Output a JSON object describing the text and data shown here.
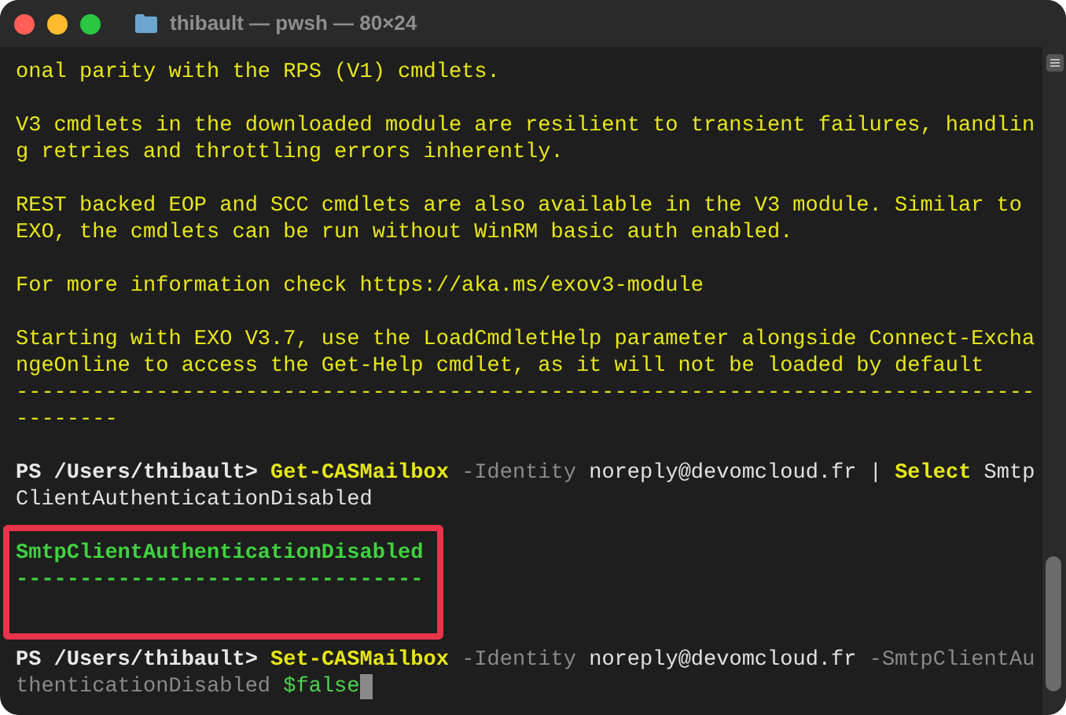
{
  "window": {
    "title": "thibault — pwsh — 80×24"
  },
  "terminal": {
    "lines": [
      {
        "kind": "text",
        "segments": [
          {
            "kind": "output",
            "text": "onal parity with the RPS (V1) cmdlets."
          }
        ]
      },
      {
        "kind": "blank"
      },
      {
        "kind": "text",
        "segments": [
          {
            "kind": "output",
            "text": "V3 cmdlets in the downloaded module are resilient to transient failures, handlin"
          }
        ]
      },
      {
        "kind": "text",
        "segments": [
          {
            "kind": "output",
            "text": "g retries and throttling errors inherently."
          }
        ]
      },
      {
        "kind": "blank"
      },
      {
        "kind": "text",
        "segments": [
          {
            "kind": "output",
            "text": "REST backed EOP and SCC cmdlets are also available in the V3 module. Similar to"
          }
        ]
      },
      {
        "kind": "text",
        "segments": [
          {
            "kind": "output",
            "text": "EXO, the cmdlets can be run without WinRM basic auth enabled."
          }
        ]
      },
      {
        "kind": "blank"
      },
      {
        "kind": "text",
        "segments": [
          {
            "kind": "output",
            "text": "For more information check https://aka.ms/exov3-module"
          }
        ]
      },
      {
        "kind": "blank"
      },
      {
        "kind": "text",
        "segments": [
          {
            "kind": "output",
            "text": "Starting with EXO V3.7, use the LoadCmdletHelp parameter alongside Connect-Excha"
          }
        ]
      },
      {
        "kind": "text",
        "segments": [
          {
            "kind": "output",
            "text": "ngeOnline to access the Get-Help cmdlet, as it will not be loaded by default"
          }
        ]
      },
      {
        "kind": "text",
        "segments": [
          {
            "kind": "output",
            "text": "--------------------------------------------------------------------------------"
          }
        ]
      },
      {
        "kind": "text",
        "segments": [
          {
            "kind": "output",
            "text": "--------"
          }
        ]
      },
      {
        "kind": "blank"
      },
      {
        "kind": "text",
        "segments": [
          {
            "kind": "prompt",
            "text": "PS /Users/thibault>"
          },
          {
            "kind": "command",
            "text": "Get-CASMailbox"
          },
          {
            "kind": "parameter",
            "text": "-Identity"
          },
          {
            "kind": "argument",
            "text": "noreply@devomcloud.fr"
          },
          {
            "kind": "argument",
            "text": "|"
          },
          {
            "kind": "command",
            "text": "Select"
          },
          {
            "kind": "argument",
            "text": "Smtp"
          }
        ]
      },
      {
        "kind": "text",
        "segments": [
          {
            "kind": "argument",
            "text": "ClientAuthenticationDisabled"
          }
        ]
      },
      {
        "kind": "blank"
      },
      {
        "kind": "box",
        "lines": [
          {
            "kind": "text",
            "segments": [
              {
                "kind": "result",
                "text": "SmtpClientAuthenticationDisabled"
              }
            ]
          },
          {
            "kind": "text",
            "segments": [
              {
                "kind": "result",
                "text": "--------------------------------"
              }
            ]
          },
          {
            "kind": "blank"
          }
        ]
      },
      {
        "kind": "blank"
      },
      {
        "kind": "text",
        "segments": [
          {
            "kind": "prompt",
            "text": "PS /Users/thibault>"
          },
          {
            "kind": "command",
            "text": "Set-CASMailbox"
          },
          {
            "kind": "parameter",
            "text": "-Identity"
          },
          {
            "kind": "argument",
            "text": "noreply@devomcloud.fr"
          },
          {
            "kind": "parameter",
            "text": "-SmtpClientAu"
          }
        ]
      },
      {
        "kind": "text",
        "cursor": true,
        "segments": [
          {
            "kind": "parameter",
            "text": "thenticationDisabled"
          },
          {
            "kind": "variable",
            "text": "$false"
          }
        ]
      }
    ]
  }
}
